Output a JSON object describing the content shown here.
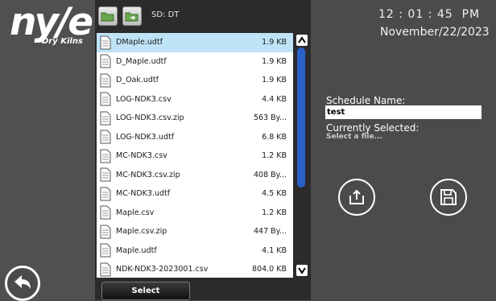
{
  "brand": {
    "logo_text": "ny/e",
    "sub_text": "Dry Kilns"
  },
  "toolbar": {
    "path": "SD: DT"
  },
  "files": [
    {
      "name": "DMaple.udtf",
      "size": "1.9 KB",
      "selected": true
    },
    {
      "name": "D_Maple.udtf",
      "size": "1.9 KB"
    },
    {
      "name": "D_Oak.udtf",
      "size": "1.9 KB"
    },
    {
      "name": "LOG-NDK3.csv",
      "size": "4.4 KB"
    },
    {
      "name": "LOG-NDK3.csv.zip",
      "size": "563 By..."
    },
    {
      "name": "LOG-NDK3.udtf",
      "size": "6.8 KB"
    },
    {
      "name": "MC-NDK3.csv",
      "size": "1.2 KB"
    },
    {
      "name": "MC-NDK3.csv.zip",
      "size": "408 By..."
    },
    {
      "name": "MC-NDK3.udtf",
      "size": "4.5 KB"
    },
    {
      "name": "Maple.csv",
      "size": "1.2 KB"
    },
    {
      "name": "Maple.csv.zip",
      "size": "447 By..."
    },
    {
      "name": "Maple.udtf",
      "size": "4.1 KB"
    },
    {
      "name": "NDK-NDK3-2023001.csv",
      "size": "804.0 KB"
    }
  ],
  "select_label": "Select",
  "clock": {
    "time": "12 : 01 : 45  PM",
    "date": "November/22/2023"
  },
  "schedule": {
    "name_label": "Schedule Name:",
    "name_value": "test",
    "current_label": "Currently Selected:",
    "current_value": "Select a file..."
  },
  "icons": {
    "back": "back-arrow-icon",
    "export": "export-icon",
    "save": "save-icon",
    "folder_open": "folder-open-icon",
    "folder_forward": "folder-forward-icon"
  },
  "colors": {
    "accent": "#2a62c9",
    "selection": "#bfe3f7"
  }
}
